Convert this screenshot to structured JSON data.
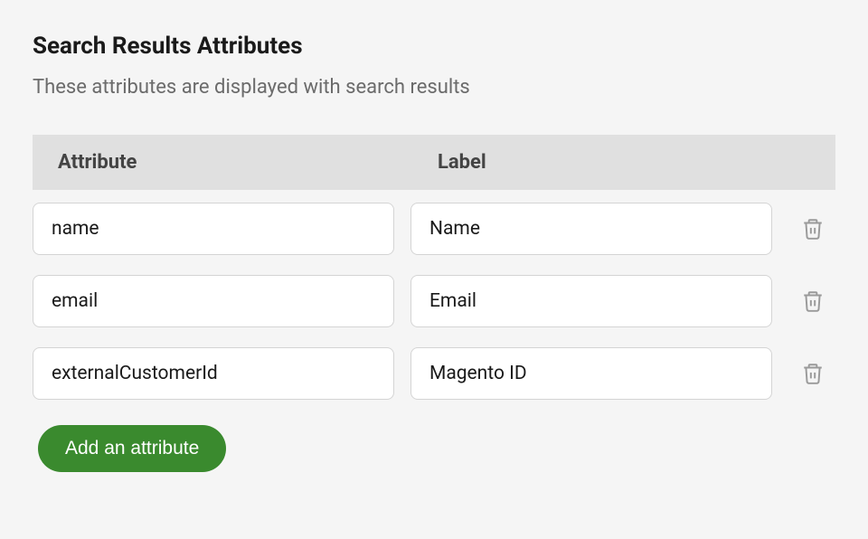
{
  "title": "Search Results Attributes",
  "subtitle": "These attributes are displayed with search results",
  "headers": {
    "attribute": "Attribute",
    "label": "Label"
  },
  "rows": [
    {
      "attribute": "name",
      "label": "Name"
    },
    {
      "attribute": "email",
      "label": "Email"
    },
    {
      "attribute": "externalCustomerId",
      "label": "Magento ID"
    }
  ],
  "add_button": "Add an attribute"
}
